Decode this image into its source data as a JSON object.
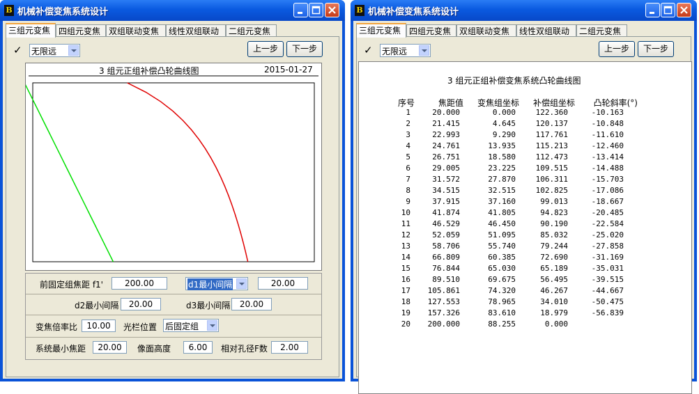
{
  "app_title": "机械补偿变焦系统设计",
  "icon_letter": "B",
  "tabs": [
    "三组元变焦",
    "四组元变焦",
    "双组联动变焦",
    "线性双组联动",
    "二组元变焦"
  ],
  "toolbar": {
    "check": "✓",
    "mode_value": "无限远",
    "prev_label": "上一步",
    "next_label": "下一步"
  },
  "chart": {
    "title": "3 组元正组补偿凸轮曲线图",
    "date": "2015-01-27",
    "colors": {
      "zoom_line": "#00e000",
      "comp_line": "#e00000"
    }
  },
  "params": {
    "front_fixed_focal_label": "前固定组焦距  f1'",
    "front_fixed_focal_value": "200.00",
    "d1_select": "d1最小间隔",
    "d1_value": "20.00",
    "d2_label": "d2最小间隔",
    "d2_value": "20.00",
    "d3_label": "d3最小间隔",
    "d3_value": "20.00",
    "zoom_ratio_label": "变焦倍率比",
    "zoom_ratio_value": "10.00",
    "stop_label": "光栏位置",
    "stop_value": "后固定组",
    "min_focal_label": "系统最小焦距",
    "min_focal_value": "20.00",
    "image_height_label": "像面高度",
    "image_height_value": "6.00",
    "fnum_label": "相对孔径F数",
    "fnum_value": "2.00"
  },
  "table": {
    "title": "3 组元正组补偿变焦系统凸轮曲线图",
    "headers": [
      "序号",
      "焦距值",
      "变焦组坐标",
      "补偿组坐标",
      "凸轮斜率(°)"
    ],
    "rows": [
      [
        "1",
        "20.000",
        "0.000",
        "122.360",
        "-10.163"
      ],
      [
        "2",
        "21.415",
        "4.645",
        "120.137",
        "-10.848"
      ],
      [
        "3",
        "22.993",
        "9.290",
        "117.761",
        "-11.610"
      ],
      [
        "4",
        "24.761",
        "13.935",
        "115.213",
        "-12.460"
      ],
      [
        "5",
        "26.751",
        "18.580",
        "112.473",
        "-13.414"
      ],
      [
        "6",
        "29.005",
        "23.225",
        "109.515",
        "-14.488"
      ],
      [
        "7",
        "31.572",
        "27.870",
        "106.311",
        "-15.703"
      ],
      [
        "8",
        "34.515",
        "32.515",
        "102.825",
        "-17.086"
      ],
      [
        "9",
        "37.915",
        "37.160",
        "99.013",
        "-18.667"
      ],
      [
        "10",
        "41.874",
        "41.805",
        "94.823",
        "-20.485"
      ],
      [
        "11",
        "46.529",
        "46.450",
        "90.190",
        "-22.584"
      ],
      [
        "12",
        "52.059",
        "51.095",
        "85.032",
        "-25.020"
      ],
      [
        "13",
        "58.706",
        "55.740",
        "79.244",
        "-27.858"
      ],
      [
        "14",
        "66.809",
        "60.385",
        "72.690",
        "-31.169"
      ],
      [
        "15",
        "76.844",
        "65.030",
        "65.189",
        "-35.031"
      ],
      [
        "16",
        "89.510",
        "69.675",
        "56.495",
        "-39.515"
      ],
      [
        "17",
        "105.861",
        "74.320",
        "46.267",
        "-44.667"
      ],
      [
        "18",
        "127.553",
        "78.965",
        "34.010",
        "-50.475"
      ],
      [
        "19",
        "157.326",
        "83.610",
        "18.979",
        "-56.839"
      ],
      [
        "20",
        "200.000",
        "88.255",
        "0.000",
        ""
      ]
    ]
  }
}
